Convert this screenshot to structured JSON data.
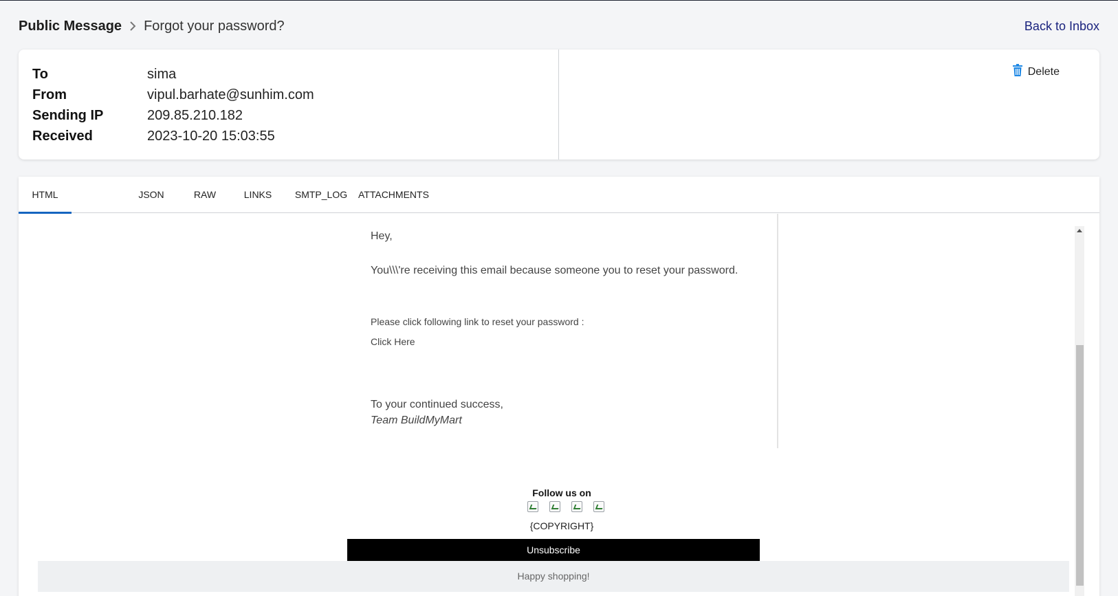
{
  "breadcrumb": {
    "root": "Public Message",
    "current": "Forgot your password?"
  },
  "back_link": "Back to Inbox",
  "meta": {
    "rows": [
      {
        "label": "To",
        "value": "sima"
      },
      {
        "label": "From",
        "value": "vipul.barhate@sunhim.com"
      },
      {
        "label": "Sending IP",
        "value": "209.85.210.182"
      },
      {
        "label": "Received",
        "value": "2023-10-20 15:03:55"
      }
    ],
    "delete_label": "Delete"
  },
  "tabs": [
    "HTML",
    "JSON",
    "RAW",
    "LINKS",
    "SMTP_LOG",
    "ATTACHMENTS"
  ],
  "active_tab": "HTML",
  "email": {
    "greeting": "Hey,",
    "intro": "You\\\\\\'re receiving this email because someone you to reset your password.",
    "instruction": "Please click following link to reset your password :",
    "link_text": "Click Here",
    "signoff": "To your continued success,",
    "team": "Team BuildMyMart",
    "follow": "Follow us on",
    "copyright": "{COPYRIGHT}",
    "unsubscribe": "Unsubscribe",
    "happy": "Happy shopping!"
  },
  "icons": {
    "breadcrumb_separator": "chevron-right-icon",
    "delete": "trash-icon",
    "social": "broken-image-icon"
  },
  "colors": {
    "accent": "#1565c0",
    "back_link": "#1a237e",
    "delete_icon": "#1e88e5"
  }
}
